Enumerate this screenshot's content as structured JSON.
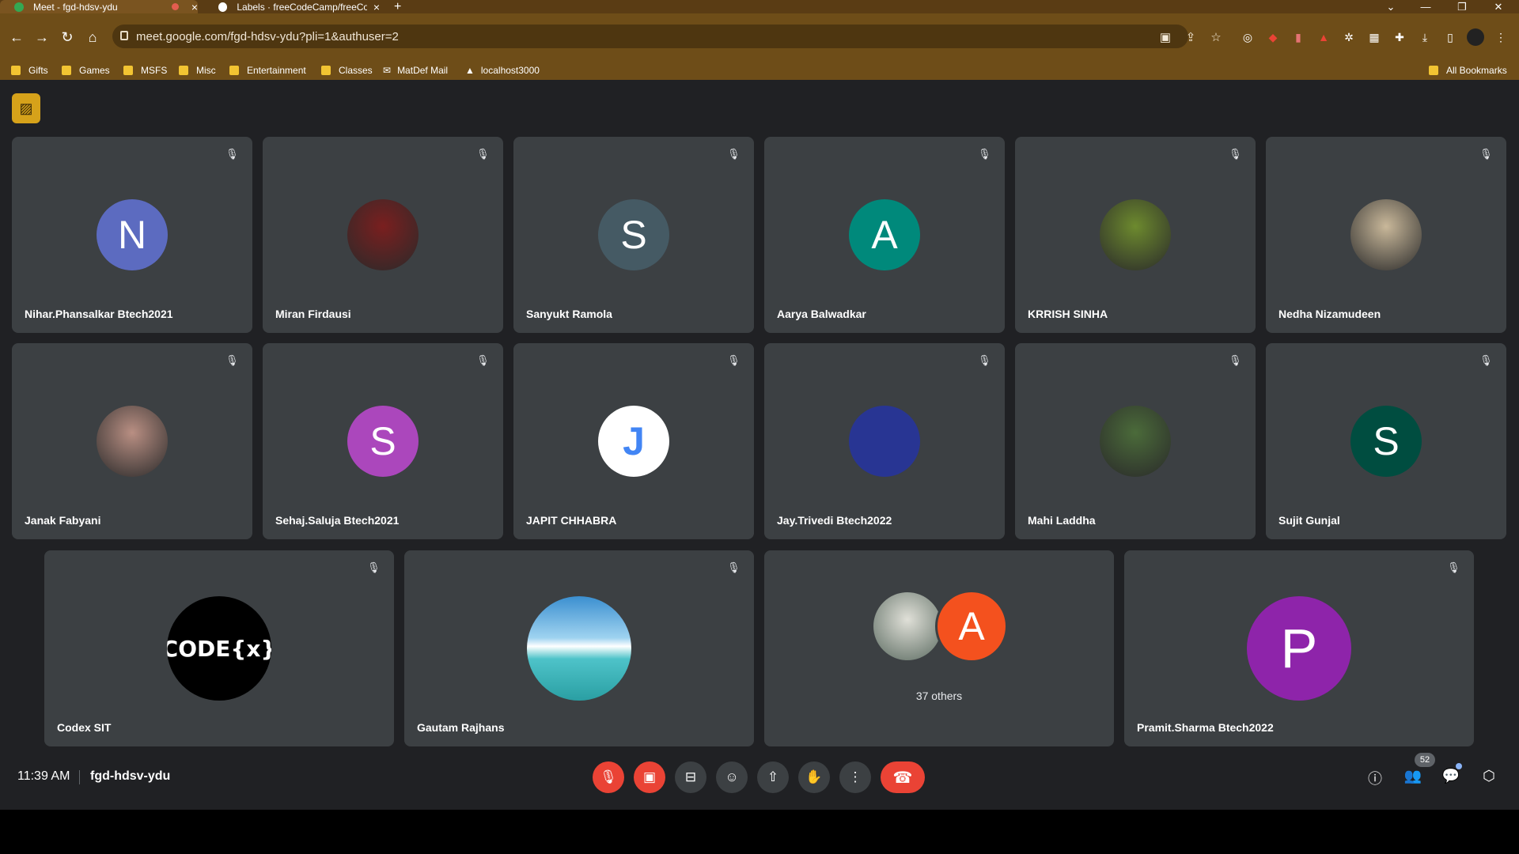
{
  "browser": {
    "tabs": [
      {
        "title": "Meet - fgd-hdsv-ydu",
        "active": true,
        "recording": true
      },
      {
        "title": "Labels · freeCodeCamp/freeCod",
        "active": false
      }
    ],
    "new_tab": "+",
    "url": "meet.google.com/fgd-hdsv-ydu?pli=1&authuser=2",
    "bookmarks": [
      "Gifts",
      "Games",
      "MSFS",
      "Misc",
      "Entertainment",
      "Classes",
      "MatDef Mail",
      "localhost3000"
    ],
    "all_bookmarks": "All Bookmarks"
  },
  "tiles": [
    {
      "name": "Nihar.Phansalkar Btech2021",
      "initial": "N",
      "color": "#5c6bc0",
      "photo": false
    },
    {
      "name": "Miran Firdausi",
      "initial": "",
      "color": "#7a1f1f",
      "photo": true
    },
    {
      "name": "Sanyukt Ramola",
      "initial": "S",
      "color": "#455a64",
      "photo": false
    },
    {
      "name": "Aarya Balwadkar",
      "initial": "A",
      "color": "#00897b",
      "photo": false
    },
    {
      "name": "KRRISH SINHA",
      "initial": "",
      "color": "#6d8a2e",
      "photo": true
    },
    {
      "name": "Nedha Nizamudeen",
      "initial": "",
      "color": "#c9b89a",
      "photo": true
    },
    {
      "name": "Janak Fabyani",
      "initial": "",
      "color": "#b98f83",
      "photo": true
    },
    {
      "name": "Sehaj.Saluja Btech2021",
      "initial": "S",
      "color": "#ab47bc",
      "photo": false
    },
    {
      "name": "JAPIT CHHABRA",
      "initial": "J",
      "color": "#ffffff",
      "photo": false
    },
    {
      "name": "Jay.Trivedi Btech2022",
      "initial": "",
      "color": "#283593",
      "photo": false
    },
    {
      "name": "Mahi Laddha",
      "initial": "",
      "color": "#4b6b3a",
      "photo": true
    },
    {
      "name": "Sujit Gunjal",
      "initial": "S",
      "color": "#004d40",
      "photo": false
    }
  ],
  "bottom_tiles": [
    {
      "name": "Codex SIT",
      "logo": "CODE{x}",
      "color": "#000000"
    },
    {
      "name": "Gautam Rajhans",
      "color": "#4aa3c8"
    },
    {
      "others": "37 others",
      "initial": "A",
      "color": "#f4511e"
    },
    {
      "name": "Pramit.Sharma Btech2022",
      "initial": "P",
      "color": "#8e24aa"
    }
  ],
  "footer": {
    "time": "11:39 AM",
    "meeting_code": "fgd-hdsv-ydu",
    "participant_count": "52"
  }
}
